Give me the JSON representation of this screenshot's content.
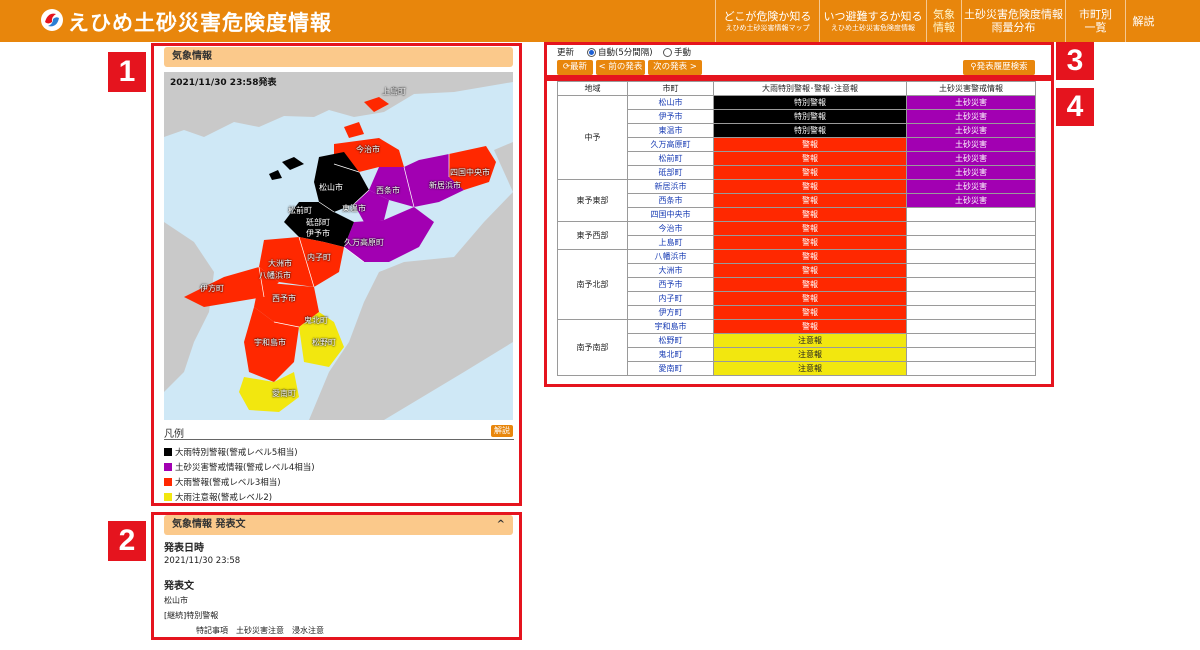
{
  "header": {
    "title": "えひめ土砂災害危険度情報",
    "nav": [
      {
        "l1": "どこが危険か知る",
        "l2": "えひめ土砂災害情報マップ"
      },
      {
        "l1": "いつ避難するか知る",
        "l2": "えひめ土砂災害危険度情報"
      },
      {
        "l1": "気象",
        "l3": "情報"
      },
      {
        "l1": "土砂災害危険度情報",
        "l3": "雨量分布"
      },
      {
        "l1": "市町別",
        "l3": "一覧"
      },
      {
        "l1": "解説"
      }
    ]
  },
  "markers": [
    "1",
    "2",
    "3",
    "4"
  ],
  "weather_panel": {
    "title": "気象情報",
    "map_time": "2021/11/30 23:58発表",
    "map_labels": [
      "上島町",
      "今治市",
      "松山市",
      "西条市",
      "新居浜市",
      "四国中央市",
      "東温市",
      "松前町",
      "砥部町",
      "伊予市",
      "久万高原町",
      "大洲市",
      "内子町",
      "八幡浜市",
      "伊方町",
      "西予市",
      "鬼北町",
      "宇和島市",
      "松野町",
      "愛南町"
    ],
    "legend_title": "凡例",
    "legend_button": "解説",
    "legend": [
      {
        "label": "大雨特別警報(警戒レベル5相当)",
        "color": "#000000"
      },
      {
        "label": "土砂災害警戒情報(警戒レベル4相当)",
        "color": "#a200b2"
      },
      {
        "label": "大雨警報(警戒レベル3相当)",
        "color": "#ff2800"
      },
      {
        "label": "大雨注意報(警戒レベル2)",
        "color": "#f2e70f"
      }
    ]
  },
  "bulletin": {
    "title": "気象情報 発表文",
    "toggle_icon": "^",
    "date_label": "発表日時",
    "date_value": "2021/11/30 23:58",
    "text_label": "発表文",
    "lines": [
      "松山市",
      "[継続]特別警報",
      "　特記事項　土砂災害注意　浸水注意"
    ]
  },
  "controls": {
    "update_label": "更新",
    "auto_label": "自動(5分間隔)",
    "manual_label": "手動",
    "latest_button": "最新",
    "prev_button": "< 前の発表",
    "next_button": "次の発表 >",
    "history_button": "発表履歴検索"
  },
  "table": {
    "headers": [
      "地域",
      "市町",
      "大雨特別警報･警報･注意報",
      "土砂災害警戒情報"
    ],
    "groups": [
      {
        "region": "中予",
        "rows": [
          {
            "city": "松山市",
            "warning": "特別警報",
            "landslide": "土砂災害"
          },
          {
            "city": "伊予市",
            "warning": "特別警報",
            "landslide": "土砂災害"
          },
          {
            "city": "東温市",
            "warning": "特別警報",
            "landslide": "土砂災害"
          },
          {
            "city": "久万高原町",
            "warning": "警報",
            "landslide": "土砂災害"
          },
          {
            "city": "松前町",
            "warning": "警報",
            "landslide": "土砂災害"
          },
          {
            "city": "砥部町",
            "warning": "警報",
            "landslide": "土砂災害"
          }
        ]
      },
      {
        "region": "東予東部",
        "rows": [
          {
            "city": "新居浜市",
            "warning": "警報",
            "landslide": "土砂災害"
          },
          {
            "city": "西条市",
            "warning": "警報",
            "landslide": "土砂災害"
          },
          {
            "city": "四国中央市",
            "warning": "警報",
            "landslide": ""
          }
        ]
      },
      {
        "region": "東予西部",
        "rows": [
          {
            "city": "今治市",
            "warning": "警報",
            "landslide": ""
          },
          {
            "city": "上島町",
            "warning": "警報",
            "landslide": ""
          }
        ]
      },
      {
        "region": "南予北部",
        "rows": [
          {
            "city": "八幡浜市",
            "warning": "警報",
            "landslide": ""
          },
          {
            "city": "大洲市",
            "warning": "警報",
            "landslide": ""
          },
          {
            "city": "西予市",
            "warning": "警報",
            "landslide": ""
          },
          {
            "city": "内子町",
            "warning": "警報",
            "landslide": ""
          },
          {
            "city": "伊方町",
            "warning": "警報",
            "landslide": ""
          }
        ]
      },
      {
        "region": "南予南部",
        "rows": [
          {
            "city": "宇和島市",
            "warning": "警報",
            "landslide": ""
          },
          {
            "city": "松野町",
            "warning": "注意報",
            "landslide": ""
          },
          {
            "city": "鬼北町",
            "warning": "注意報",
            "landslide": ""
          },
          {
            "city": "愛南町",
            "warning": "注意報",
            "landslide": ""
          }
        ]
      }
    ]
  },
  "colors": {
    "brand": "#e8860c",
    "special_warning": "#000000",
    "landslide": "#a200b2",
    "warning": "#ff2800",
    "advisory": "#f2e70f",
    "marker": "#e5141e"
  }
}
